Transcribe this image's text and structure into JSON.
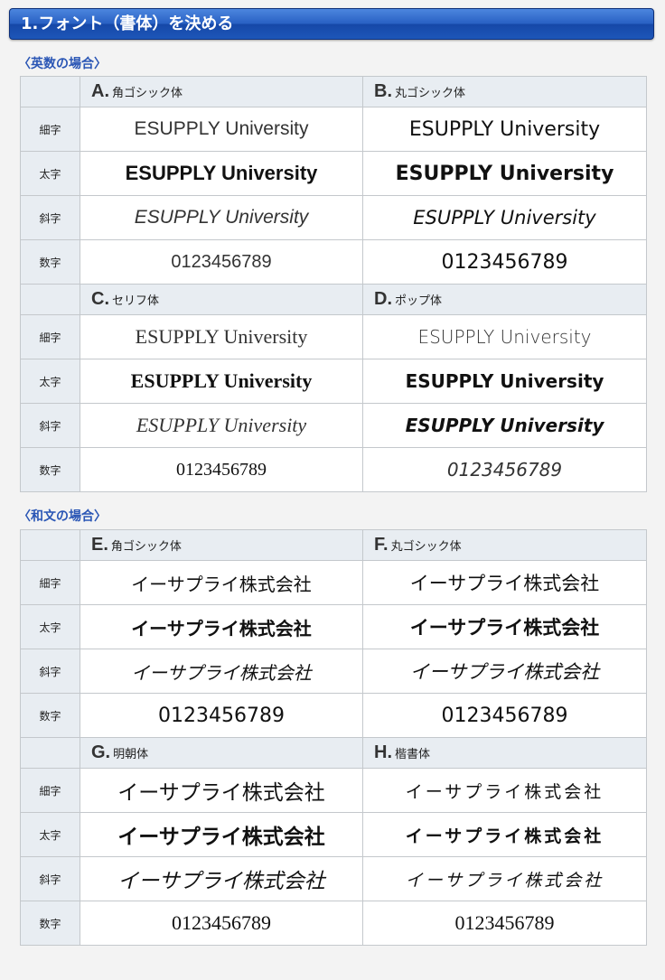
{
  "header": {
    "title": "1.フォント（書体）を決める"
  },
  "row_labels": {
    "light": "細字",
    "bold": "太字",
    "italic": "斜字",
    "number": "数字"
  },
  "english": {
    "title": "〈英数の場合〉",
    "sample": "ESUPPLY University",
    "digits": "0123456789",
    "fonts": [
      {
        "letter": "A.",
        "name": "角ゴシック体"
      },
      {
        "letter": "B.",
        "name": "丸ゴシック体"
      },
      {
        "letter": "C.",
        "name": "セリフ体"
      },
      {
        "letter": "D.",
        "name": "ポップ体"
      }
    ]
  },
  "japanese": {
    "title": "〈和文の場合〉",
    "sample": "イーサプライ株式会社",
    "digits": "0123456789",
    "fonts": [
      {
        "letter": "E.",
        "name": "角ゴシック体"
      },
      {
        "letter": "F.",
        "name": "丸ゴシック体"
      },
      {
        "letter": "G.",
        "name": "明朝体"
      },
      {
        "letter": "H.",
        "name": "楷書体"
      }
    ]
  }
}
